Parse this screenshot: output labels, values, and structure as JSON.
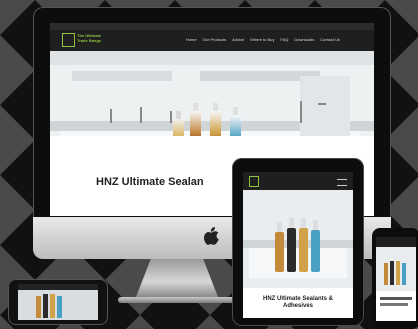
{
  "site": {
    "brand_line1": "The Ultimate",
    "brand_line2": "Trade Range",
    "top_text": "",
    "nav": [
      "Home",
      "Our Products",
      "Advice",
      "Where to Buy",
      "FAQ",
      "Downloads",
      "Contact Us"
    ],
    "hero_headline": "HNZ Ultimate Sealan",
    "tablet_headline_line1": "HNZ Ultimate Sealants &",
    "tablet_headline_line2": "Adhesives"
  },
  "colors": {
    "brand_green": "#8fc53d",
    "header_dark": "#1f1f1f",
    "background": "#3a3a3a"
  },
  "icons": [
    "apple-logo"
  ]
}
